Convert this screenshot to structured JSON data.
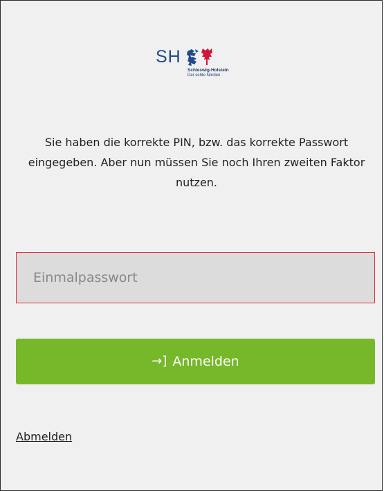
{
  "logo": {
    "abbr": "SH",
    "line1": "Schleswig-Holstein",
    "line2": "Der echte Norden",
    "colors": {
      "blue": "#1f4a8c",
      "red": "#d2143a"
    }
  },
  "message": "Sie haben die korrekte PIN, bzw. das korrekte Passwort eingegeben. Aber nun müssen Sie noch Ihren zweiten Faktor nutzen.",
  "otp": {
    "placeholder": "Einmalpasswort",
    "value": ""
  },
  "login_button": {
    "icon": "login-arrow-icon",
    "icon_glyph": "→]",
    "label": "Anmelden",
    "color": "#76b82a"
  },
  "logout_link": "Abmelden",
  "colors": {
    "background": "#f0f0f0",
    "input_border_error": "#e0303a",
    "input_background": "#dcdcdc"
  }
}
